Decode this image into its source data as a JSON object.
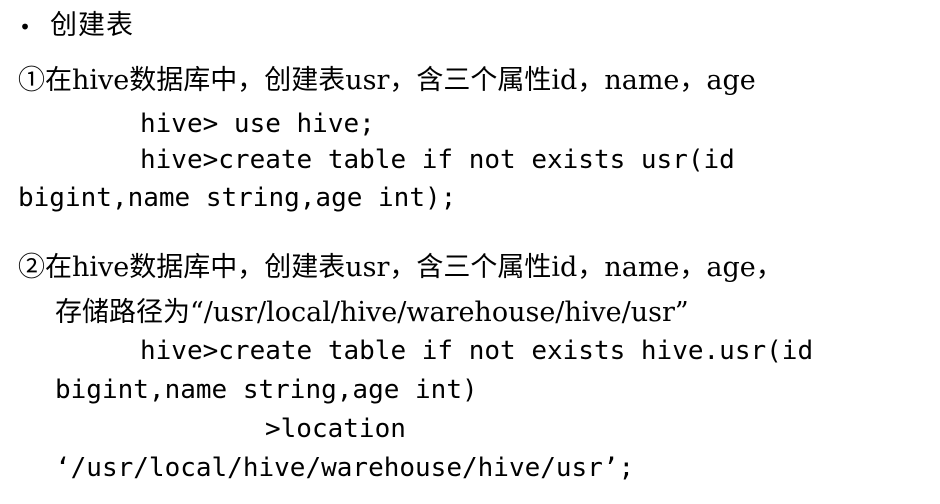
{
  "slide": {
    "background_color": "#ffffff",
    "text_color": "#000000",
    "bullet": {
      "marker": "•",
      "text": "创建表"
    },
    "items": [
      {
        "marker_and_text": "①在hive数据库中，创建表usr，含三个属性id，name，age",
        "code_lines": [
          "hive> use hive;",
          "hive>create table if not exists usr(id",
          "bigint,name string,age int);"
        ]
      },
      {
        "marker_and_text": "②在hive数据库中，创建表usr，含三个属性id，name，age，",
        "second_line": "存储路径为“/usr/local/hive/warehouse/hive/usr”",
        "code_lines": [
          "hive>create table if not exists hive.usr(id",
          "bigint,name string,age int)",
          ">location",
          "‘/usr/local/hive/warehouse/hive/usr’;"
        ]
      }
    ]
  }
}
